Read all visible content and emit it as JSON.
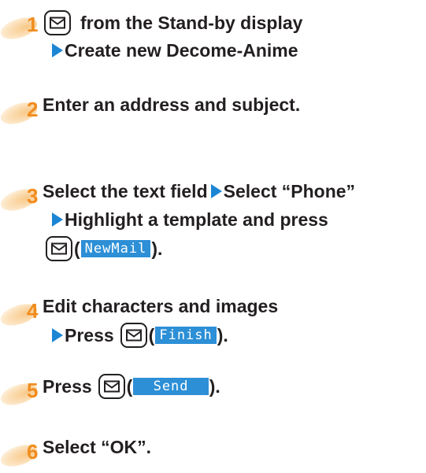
{
  "steps": [
    {
      "number": "1",
      "lines": {
        "a": "from the Stand-by display",
        "b": "Create new Decome-Anime"
      }
    },
    {
      "number": "2",
      "lines": {
        "a": "Enter an address and subject."
      }
    },
    {
      "number": "3",
      "lines": {
        "a1": "Select the text field",
        "a2": "Select “Phone”",
        "b": "Highlight a template and press",
        "c_open": "(",
        "c_softkey": "NewMail",
        "c_close": ")."
      }
    },
    {
      "number": "4",
      "lines": {
        "a": "Edit characters and images",
        "b_press": "Press",
        "b_open": "(",
        "b_softkey": "Finish",
        "b_close": ")."
      }
    },
    {
      "number": "5",
      "lines": {
        "a_press": "Press",
        "a_open": "(",
        "a_softkey": " Send ",
        "a_close": ")."
      }
    },
    {
      "number": "6",
      "lines": {
        "a": "Select “OK”."
      }
    }
  ],
  "colors": {
    "arrow": "#1c86d4",
    "step_number": "#f08c1e",
    "softkey_bg": "#2d8fd6"
  },
  "icons": {
    "mail_key": "mail-key-icon",
    "arrow": "triangle-right-icon"
  }
}
